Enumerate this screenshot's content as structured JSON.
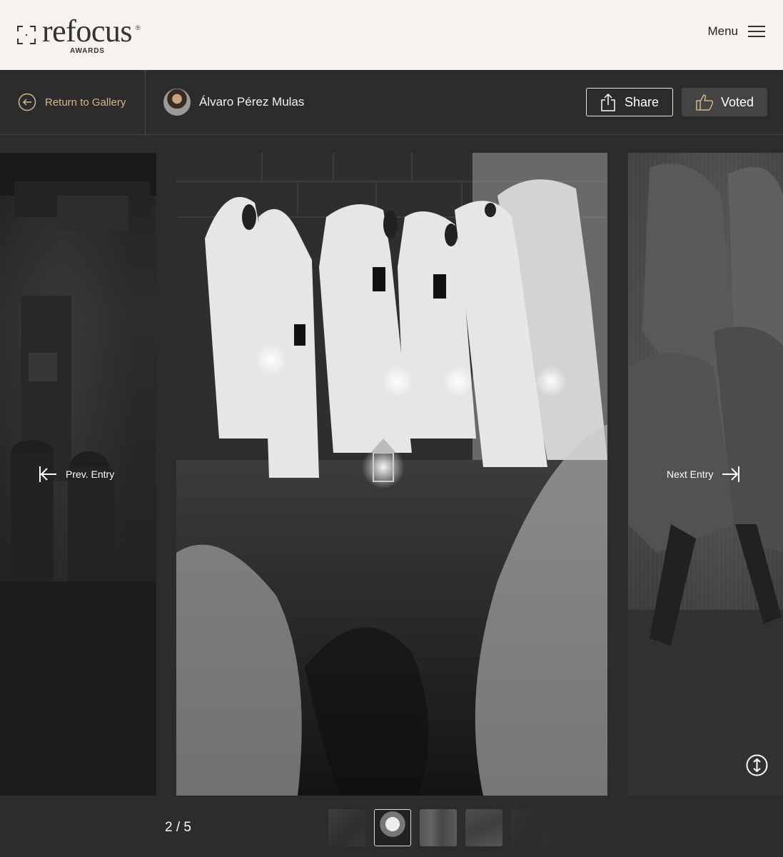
{
  "header": {
    "logo_text": "refocus",
    "logo_reg": "®",
    "logo_sub": "AWARDS",
    "menu_label": "Menu"
  },
  "toolbar": {
    "return_label": "Return to Gallery",
    "author_name": "Álvaro Pérez Mulas",
    "share_label": "Share",
    "voted_label": "Voted"
  },
  "gallery": {
    "prev_label": "Prev. Entry",
    "next_label": "Next Entry"
  },
  "footer": {
    "counter": "2 / 5",
    "thumbnails": [
      "thumb-1",
      "thumb-2",
      "thumb-3",
      "thumb-4",
      "thumb-5"
    ],
    "active_index": 2,
    "total": 5
  },
  "colors": {
    "header_bg": "#f6f3ee",
    "page_bg": "#2c2c2c",
    "accent": "#d4b58a",
    "voted_bg": "#444444"
  },
  "icons": [
    "logo-bracket-icon",
    "hamburger-icon",
    "back-arrow-icon",
    "share-icon",
    "thumbs-up-icon",
    "prev-arrow-icon",
    "next-arrow-icon",
    "scroll-icon"
  ]
}
